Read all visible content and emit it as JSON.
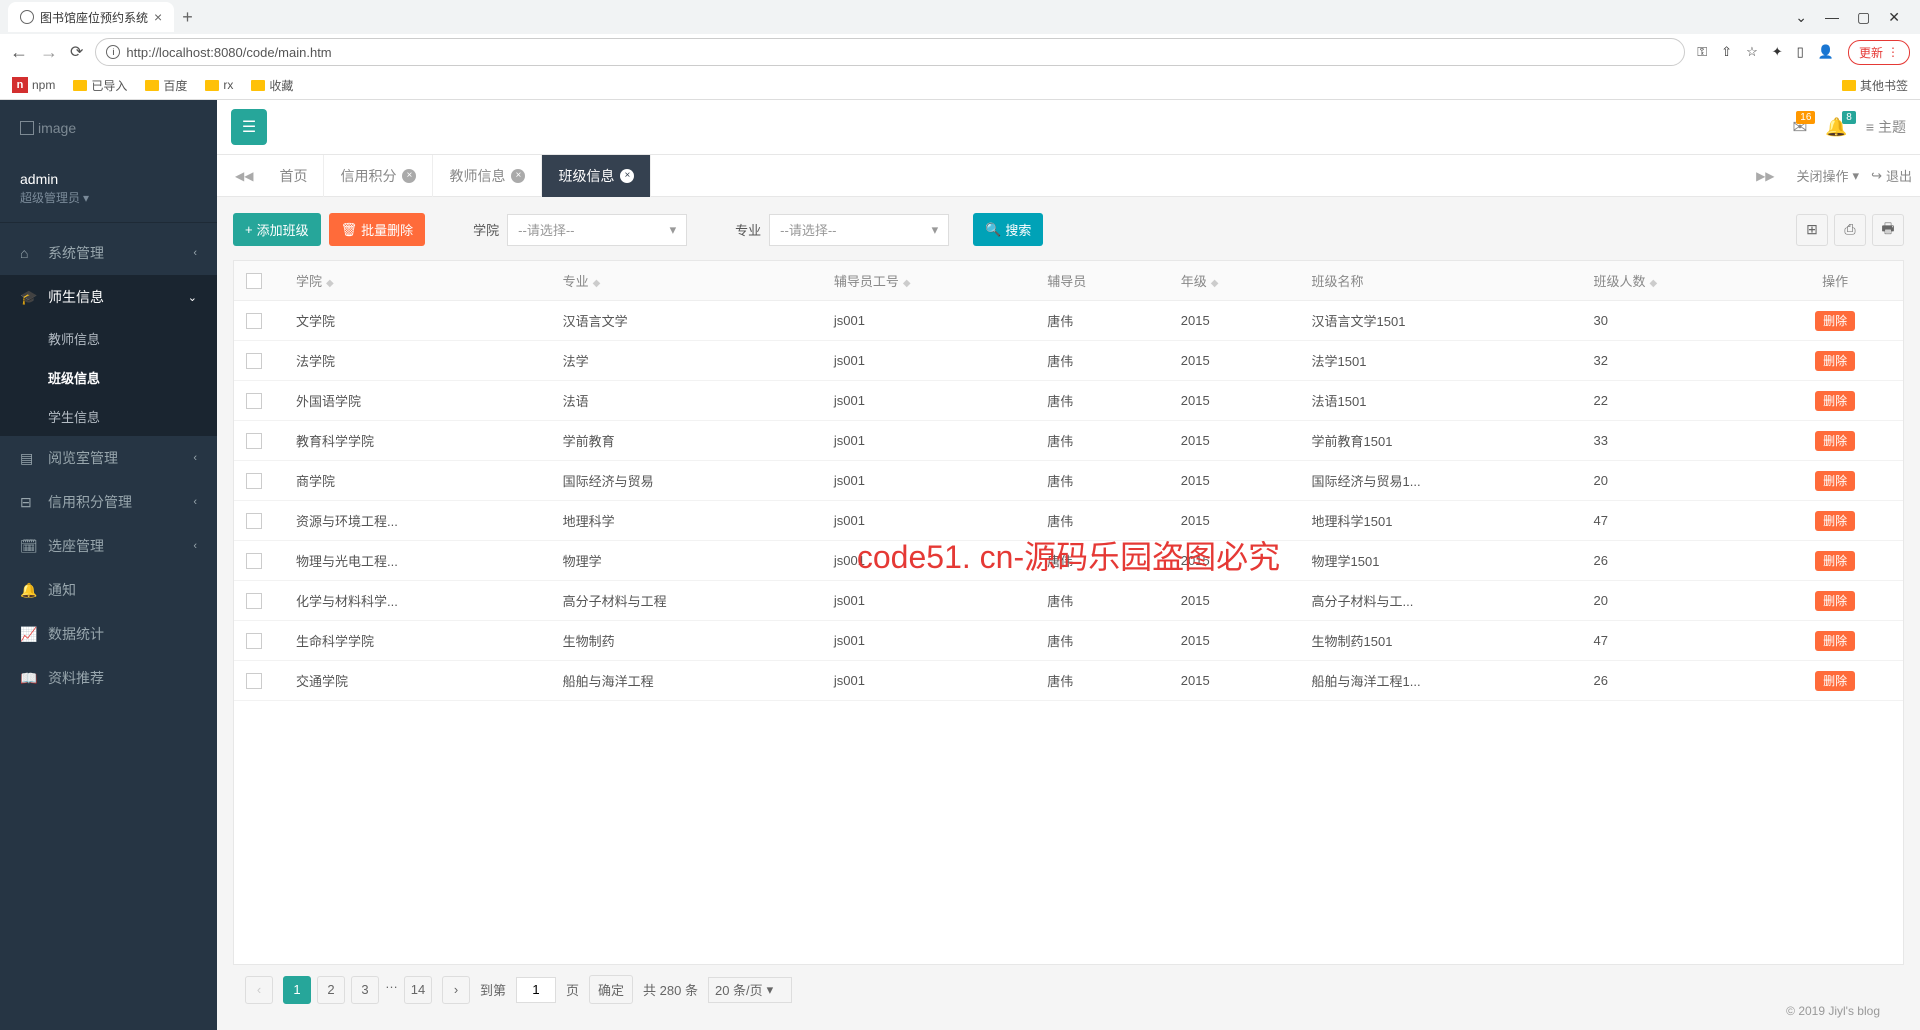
{
  "browser": {
    "tab_title": "图书馆座位预约系统",
    "url": "http://localhost:8080/code/main.htm",
    "update_btn": "更新",
    "bookmarks": [
      "npm",
      "已导入",
      "百度",
      "rx",
      "收藏"
    ],
    "other_bookmarks": "其他书签"
  },
  "sidebar": {
    "logo": "image",
    "user_name": "admin",
    "user_role": "超级管理员",
    "menu": [
      {
        "icon": "⌂",
        "label": "系统管理",
        "chev": "‹"
      },
      {
        "icon": "🎓",
        "label": "师生信息",
        "chev": "⌄",
        "expanded": true,
        "sub": [
          "教师信息",
          "班级信息",
          "学生信息"
        ],
        "active_sub": 1
      },
      {
        "icon": "▤",
        "label": "阅览室管理",
        "chev": "‹"
      },
      {
        "icon": "⊟",
        "label": "信用积分管理",
        "chev": "‹"
      },
      {
        "icon": "🗓",
        "label": "选座管理",
        "chev": "‹"
      },
      {
        "icon": "🔔",
        "label": "通知",
        "chev": ""
      },
      {
        "icon": "📈",
        "label": "数据统计",
        "chev": ""
      },
      {
        "icon": "📖",
        "label": "资料推荐",
        "chev": ""
      }
    ]
  },
  "topbar": {
    "badge1": "16",
    "badge2": "8",
    "theme": "主题"
  },
  "tabs": {
    "items": [
      {
        "label": "首页",
        "closable": false
      },
      {
        "label": "信用积分",
        "closable": true
      },
      {
        "label": "教师信息",
        "closable": true
      },
      {
        "label": "班级信息",
        "closable": true,
        "active": true
      }
    ],
    "close_ops": "关闭操作",
    "exit": "退出"
  },
  "toolbar": {
    "add": "添加班级",
    "batch_del": "批量删除",
    "college_label": "学院",
    "major_label": "专业",
    "placeholder": "--请选择--",
    "search": "搜索"
  },
  "table": {
    "headers": [
      "学院",
      "专业",
      "辅导员工号",
      "辅导员",
      "年级",
      "班级名称",
      "班级人数",
      "操作"
    ],
    "delete_label": "删除",
    "rows": [
      [
        "文学院",
        "汉语言文学",
        "js001",
        "唐伟",
        "2015",
        "汉语言文学1501",
        "30"
      ],
      [
        "法学院",
        "法学",
        "js001",
        "唐伟",
        "2015",
        "法学1501",
        "32"
      ],
      [
        "外国语学院",
        "法语",
        "js001",
        "唐伟",
        "2015",
        "法语1501",
        "22"
      ],
      [
        "教育科学学院",
        "学前教育",
        "js001",
        "唐伟",
        "2015",
        "学前教育1501",
        "33"
      ],
      [
        "商学院",
        "国际经济与贸易",
        "js001",
        "唐伟",
        "2015",
        "国际经济与贸易1...",
        "20"
      ],
      [
        "资源与环境工程...",
        "地理科学",
        "js001",
        "唐伟",
        "2015",
        "地理科学1501",
        "47"
      ],
      [
        "物理与光电工程...",
        "物理学",
        "js001",
        "唐伟",
        "2015",
        "物理学1501",
        "26"
      ],
      [
        "化学与材料科学...",
        "高分子材料与工程",
        "js001",
        "唐伟",
        "2015",
        "高分子材料与工...",
        "20"
      ],
      [
        "生命科学学院",
        "生物制药",
        "js001",
        "唐伟",
        "2015",
        "生物制药1501",
        "47"
      ],
      [
        "交通学院",
        "船舶与海洋工程",
        "js001",
        "唐伟",
        "2015",
        "船舶与海洋工程1...",
        "26"
      ]
    ]
  },
  "pagination": {
    "pages": [
      "1",
      "2",
      "3",
      "…",
      "14"
    ],
    "goto_label": "到第",
    "goto_value": "1",
    "page_unit": "页",
    "confirm": "确定",
    "total": "共 280 条",
    "per_page": "20 条/页"
  },
  "footer": "© 2019 Jiyl's blog",
  "watermark": "code51. cn-源码乐园盗图必究"
}
